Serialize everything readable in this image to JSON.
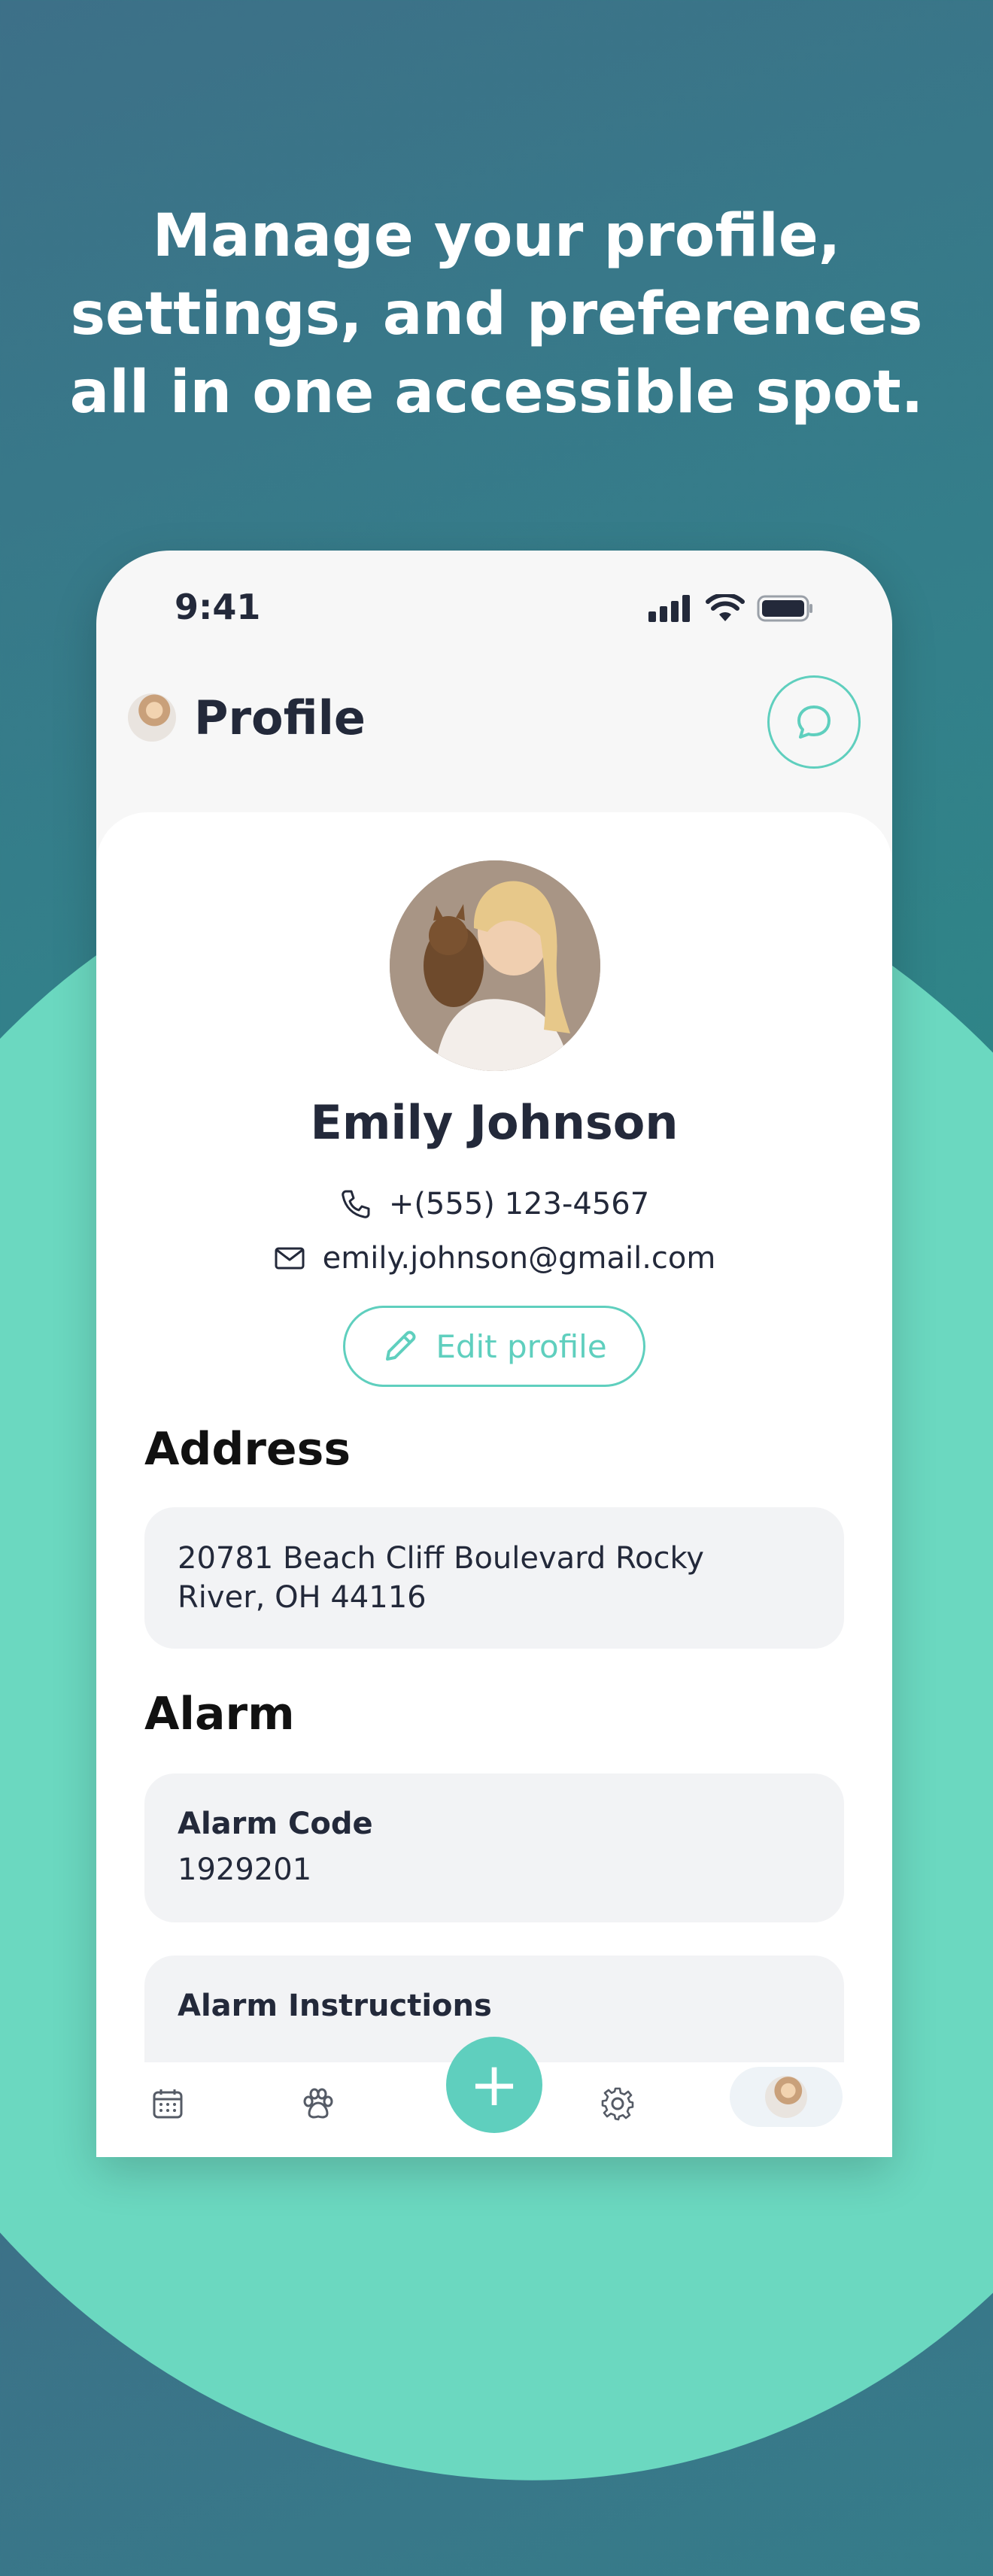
{
  "headline": {
    "line1": "Manage your profile,",
    "line2": "settings, and preferences",
    "line3": "all in one accessible spot."
  },
  "status_bar": {
    "time": "9:41"
  },
  "header": {
    "title": "Profile"
  },
  "profile": {
    "name": "Emily Johnson",
    "phone": "+(555) 123-4567",
    "email": "emily.johnson@gmail.com",
    "edit_label": "Edit profile"
  },
  "address": {
    "title": "Address",
    "line1": "20781 Beach Cliff Boulevard Rocky",
    "line2": "River, OH 44116"
  },
  "alarm": {
    "title": "Alarm",
    "code_label": "Alarm Code",
    "code_value": "1929201",
    "instructions_label": "Alarm Instructions"
  },
  "tabbar": {
    "fab_symbol": "+",
    "items": [
      "calendar-icon",
      "paw-icon",
      "add-button",
      "settings-icon",
      "profile-avatar"
    ]
  },
  "colors": {
    "accent": "#5fcfbe",
    "text": "#23293a",
    "background_top": "#3d7088",
    "background_wave": "#6bd8c0"
  }
}
